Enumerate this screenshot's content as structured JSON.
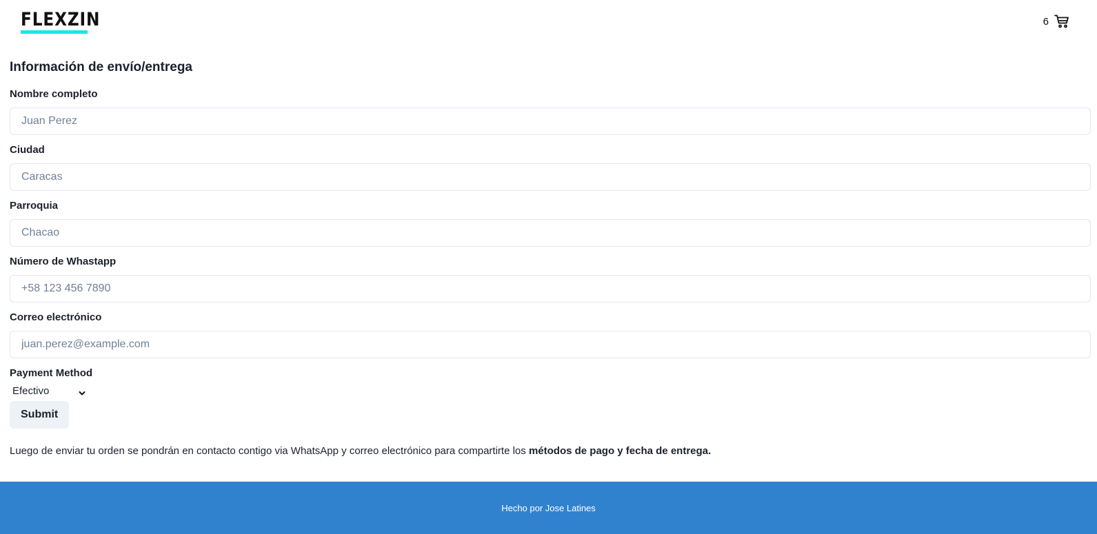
{
  "header": {
    "logo_text": "FLEXZIN",
    "logo_accent_color": "#19e6e6",
    "cart_count": "6",
    "cart_icon": "shopping-cart-icon"
  },
  "form": {
    "title": "Información de envío/entrega",
    "fields": [
      {
        "label": "Nombre completo",
        "placeholder": "Juan Perez",
        "value": ""
      },
      {
        "label": "Ciudad",
        "placeholder": "Caracas",
        "value": ""
      },
      {
        "label": "Parroquia",
        "placeholder": "Chacao",
        "value": ""
      },
      {
        "label": "Número de Whastapp",
        "placeholder": "+58 123 456 7890",
        "value": ""
      },
      {
        "label": "Correo electrónico",
        "placeholder": "juan.perez@example.com",
        "value": ""
      }
    ],
    "payment": {
      "label": "Payment Method",
      "selected": "Efectivo",
      "chevron_icon": "chevron-down-icon"
    },
    "submit_label": "Submit"
  },
  "note": {
    "text": "Luego de enviar tu orden se pondrán en contacto contigo via WhatsApp y correo electrónico para compartirte los ",
    "bold": "métodos de pago y fecha de entrega."
  },
  "footer": {
    "text": "Hecho por Jose Latines",
    "background_color": "#3182ce"
  }
}
